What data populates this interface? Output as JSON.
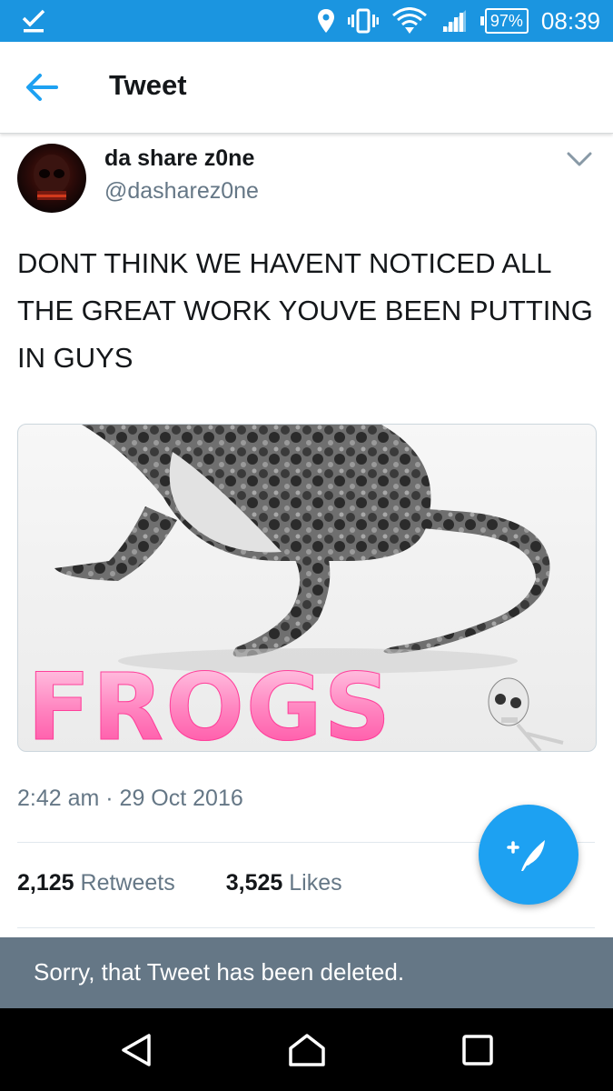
{
  "status_bar": {
    "notification_icon": "download-done-icon",
    "battery": "97%",
    "time": "08:39",
    "accent": "#1b95e0"
  },
  "header": {
    "back_icon": "arrow-left-icon",
    "title": "Tweet"
  },
  "tweet": {
    "author_name": "da share z0ne",
    "author_handle": "@dasharez0ne",
    "text": "DONT THINK WE HAVENT NOTICED ALL THE GREAT WORK YOUVE BEEN PUTTING IN GUYS",
    "media_caption": "FROGS",
    "timestamp": "2:42 am · 29 Oct 2016",
    "retweets_count": "2,125",
    "retweets_label": "Retweets",
    "likes_count": "3,525",
    "likes_label": "Likes"
  },
  "compose_fab": {
    "icon": "compose-feather-icon",
    "color": "#1da1f2"
  },
  "toast": {
    "message": "Sorry, that  Tweet has been deleted."
  },
  "nav_bar": {
    "back_icon": "triangle-back-icon",
    "home_icon": "home-icon",
    "recents_icon": "square-recents-icon"
  }
}
